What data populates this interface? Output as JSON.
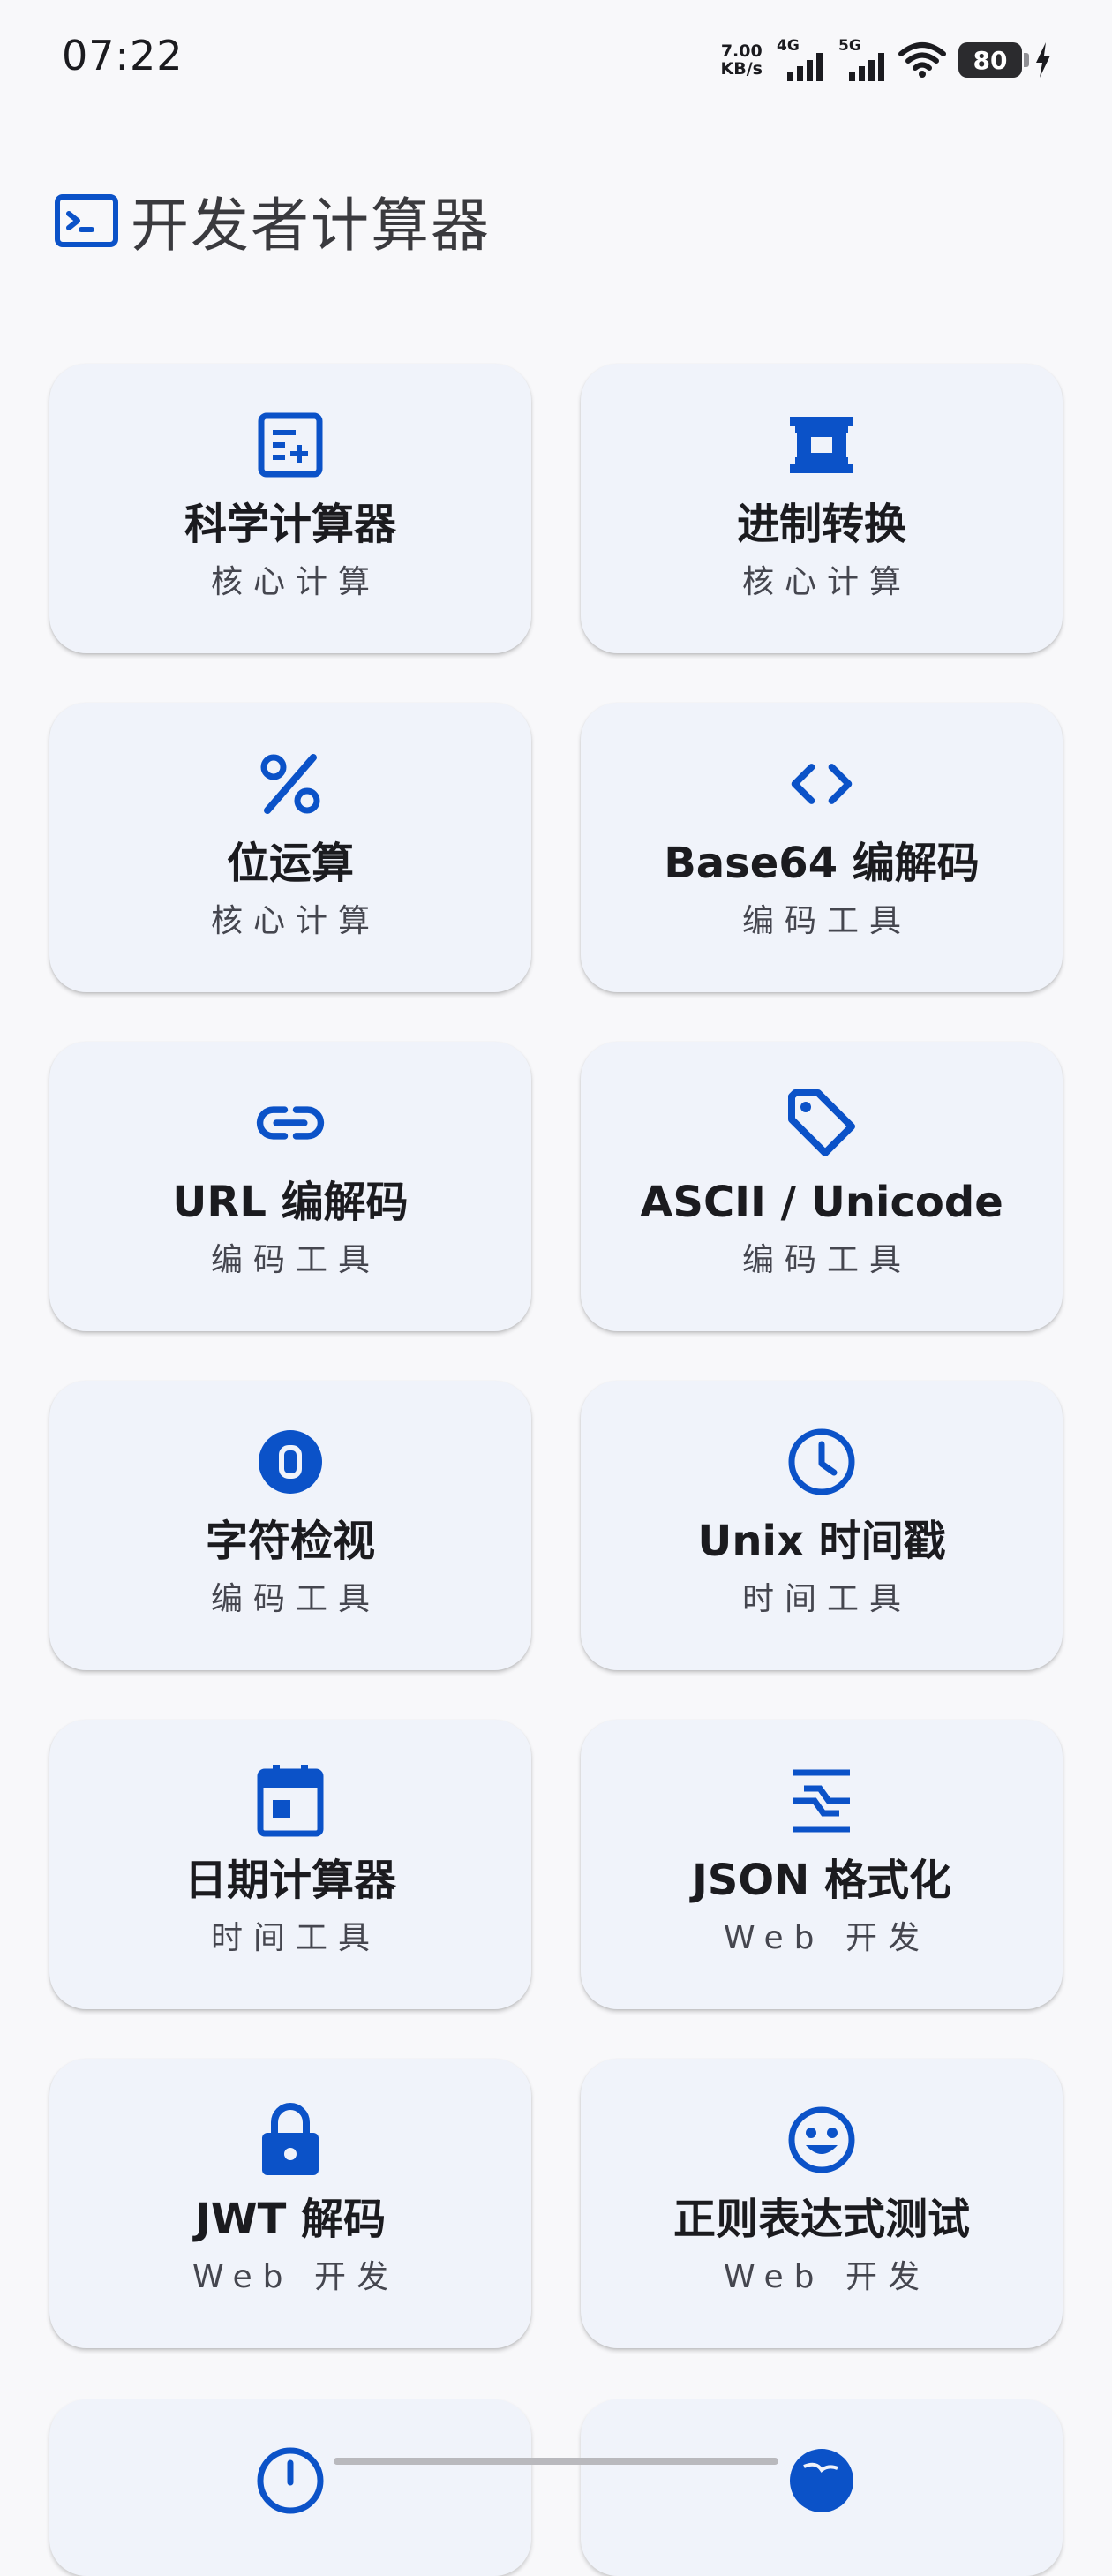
{
  "status_bar": {
    "time": "07:22",
    "net_speed_value": "7.00",
    "net_speed_unit": "KB/s",
    "signal_1_label": "4G",
    "signal_2_label": "5G",
    "battery_level": "80"
  },
  "header": {
    "title": "开发者计算器",
    "icon": "terminal-icon"
  },
  "accent_color": "#0b52c8",
  "tools": [
    {
      "name": "科学计算器",
      "category": "核心计算",
      "icon": "calculator-icon"
    },
    {
      "name": "进制转换",
      "category": "核心计算",
      "icon": "memory-chip-icon"
    },
    {
      "name": "位运算",
      "category": "核心计算",
      "icon": "percent-icon"
    },
    {
      "name": "Base64 编解码",
      "category": "编码工具",
      "icon": "code-brackets-icon"
    },
    {
      "name": "URL 编解码",
      "category": "编码工具",
      "icon": "link-icon"
    },
    {
      "name": "ASCII / Unicode",
      "category": "编码工具",
      "icon": "tag-icon"
    },
    {
      "name": "字符检视",
      "category": "编码工具",
      "icon": "zero-circle-icon"
    },
    {
      "name": "Unix 时间戳",
      "category": "时间工具",
      "icon": "clock-icon"
    },
    {
      "name": "日期计算器",
      "category": "时间工具",
      "icon": "calendar-icon"
    },
    {
      "name": "JSON 格式化",
      "category": "Web 开发",
      "icon": "data-object-icon"
    },
    {
      "name": "JWT 解码",
      "category": "Web 开发",
      "icon": "lock-icon"
    },
    {
      "name": "正则表达式测试",
      "category": "Web 开发",
      "icon": "smile-icon"
    }
  ]
}
